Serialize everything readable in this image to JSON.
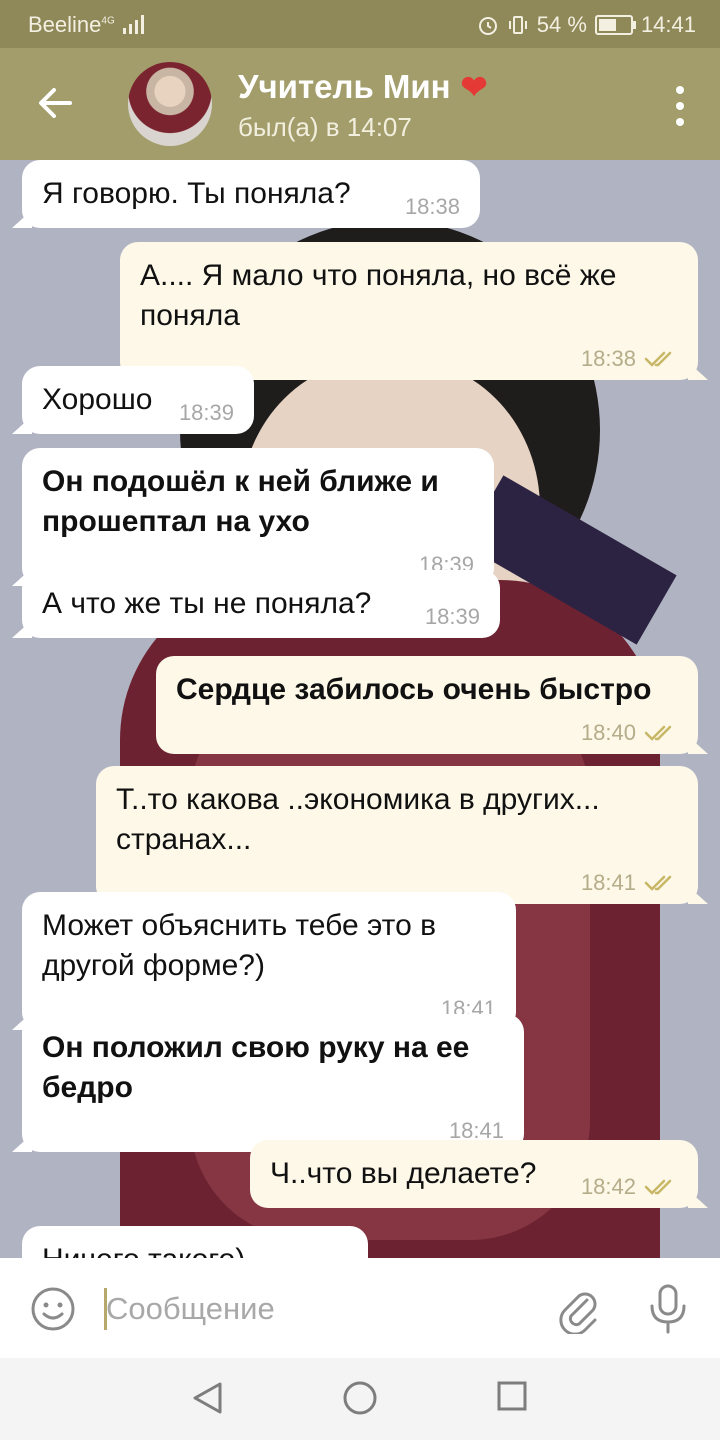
{
  "status_bar": {
    "carrier": "Beeline",
    "network": "4G",
    "battery": "54 %",
    "time": "14:41"
  },
  "header": {
    "contact_name": "Учитель Мин",
    "heart": "❤",
    "last_seen": "был(а) в 14:07"
  },
  "messages": [
    {
      "dir": "in",
      "bold": false,
      "text": "Я говорю. Ты поняла?",
      "time": "18:38"
    },
    {
      "dir": "out",
      "bold": false,
      "text": "А.... Я мало что поняла, но всё же поняла",
      "time": "18:38"
    },
    {
      "dir": "in",
      "bold": false,
      "text": "Хорошо",
      "time": "18:39"
    },
    {
      "dir": "in",
      "bold": true,
      "text": "Он подошёл к ней ближе и прошептал на ухо",
      "time": "18:39"
    },
    {
      "dir": "in",
      "bold": false,
      "text": "А что же ты не поняла?",
      "time": "18:39"
    },
    {
      "dir": "out",
      "bold": true,
      "text": "Сердце забилось очень быстро",
      "time": "18:40"
    },
    {
      "dir": "out",
      "bold": false,
      "text": "Т..то какова ..экономика в других... странах...",
      "time": "18:41"
    },
    {
      "dir": "in",
      "bold": false,
      "text": "Может объяснить тебе это в другой форме?)",
      "time": "18:41"
    },
    {
      "dir": "in",
      "bold": true,
      "text": "Он положил свою руку на ее бедро",
      "time": "18:41"
    },
    {
      "dir": "out",
      "bold": false,
      "text": "Ч..что вы делаете?",
      "time": "18:42"
    },
    {
      "dir": "in",
      "bold": false,
      "text": "Ничего такого)",
      "time": ""
    }
  ],
  "input": {
    "placeholder": "Сообщение"
  },
  "colors": {
    "header": "#a29d6b",
    "status_bar": "#8f8858",
    "incoming_bubble": "#ffffff",
    "outgoing_bubble": "#fdf8e8",
    "read_check": "#c8b766"
  }
}
